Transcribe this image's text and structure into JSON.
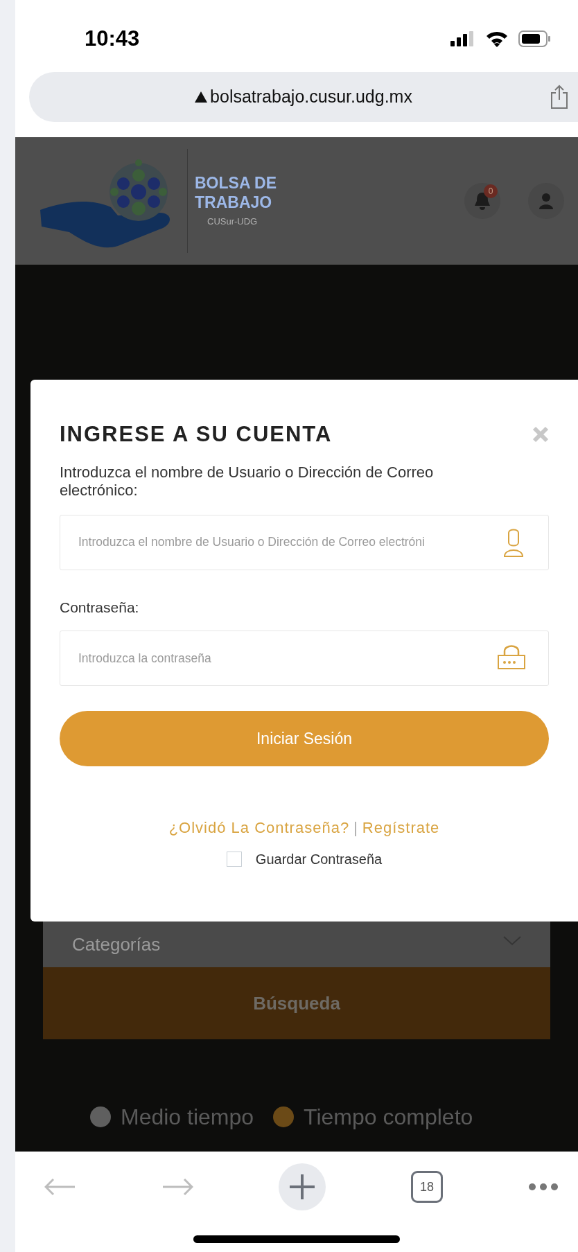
{
  "status_bar": {
    "time": "10:43"
  },
  "browser": {
    "url": "bolsatrabajo.cusur.udg.mx",
    "tab_count": "18"
  },
  "header": {
    "logo_title": "BOLSA DE TRABAJO",
    "logo_subtitle": "CUSur-UDG",
    "notification_count": "0"
  },
  "search_form": {
    "category_placeholder": "Categorías",
    "search_button": "Búsqueda",
    "legend": [
      {
        "label": "Medio tiempo",
        "color": "#5f5f5f"
      },
      {
        "label": "Tiempo completo",
        "color": "#6b4a17"
      }
    ]
  },
  "login_modal": {
    "title": "INGRESE A SU CUENTA",
    "username_label": "Introduzca el nombre de Usuario o Dirección de Correo electrónico:",
    "username_placeholder": "Introduzca el nombre de Usuario o Dirección de Correo electróni",
    "password_label": "Contraseña:",
    "password_placeholder": "Introduzca la contraseña",
    "login_button": "Iniciar Sesión",
    "forgot_link": "¿Olvidó La Contraseña?",
    "separator": "|",
    "register_link": "Regístrate",
    "remember": {
      "label": "Guardar Contraseña",
      "checked": false
    }
  }
}
